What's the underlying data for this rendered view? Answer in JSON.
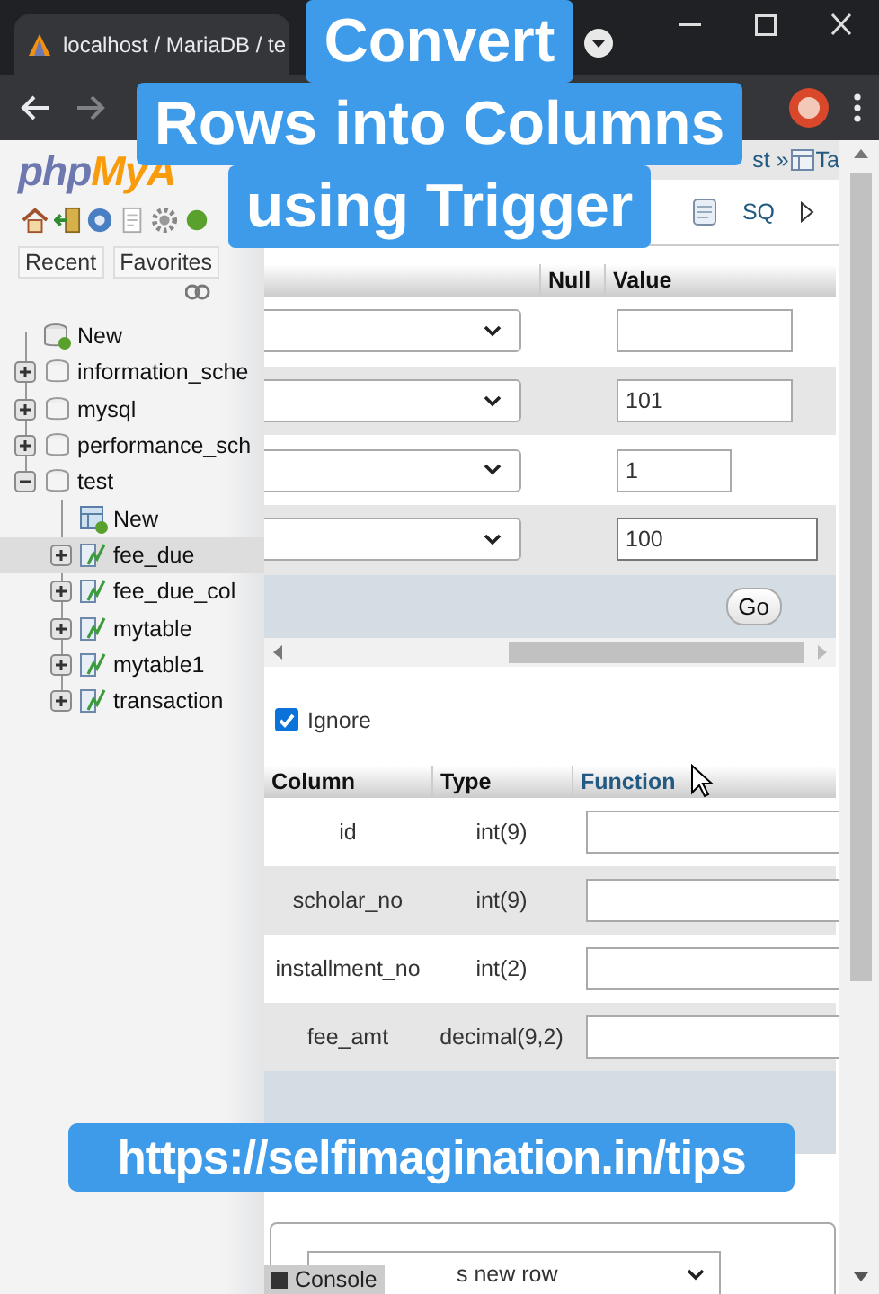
{
  "browser": {
    "tab_title": "localhost / MariaDB / te"
  },
  "captions": {
    "title_lines": [
      "Convert",
      "Rows into Columns",
      "using Trigger"
    ],
    "url": "https://selfimagination.in/tips"
  },
  "sidebar": {
    "logo": {
      "first": "php",
      "second": "MyA"
    },
    "buttons": [
      "Recent",
      "Favorites"
    ],
    "tree": [
      {
        "label": "New",
        "kind": "new",
        "selected": false
      },
      {
        "label": "information_sche",
        "kind": "db",
        "expanded": false,
        "selected": false
      },
      {
        "label": "mysql",
        "kind": "db",
        "expanded": false,
        "selected": false
      },
      {
        "label": "performance_sch",
        "kind": "db",
        "expanded": false,
        "selected": false
      },
      {
        "label": "test",
        "kind": "db",
        "expanded": true,
        "selected": false,
        "children": [
          {
            "label": "New",
            "kind": "new",
            "selected": false
          },
          {
            "label": "fee_due",
            "kind": "table",
            "expanded": false,
            "selected": true
          },
          {
            "label": "fee_due_col",
            "kind": "table",
            "expanded": false,
            "selected": false
          },
          {
            "label": "mytable",
            "kind": "table",
            "expanded": false,
            "selected": false
          },
          {
            "label": "mytable1",
            "kind": "table",
            "expanded": false,
            "selected": false
          },
          {
            "label": "transaction",
            "kind": "table",
            "expanded": false,
            "selected": false
          }
        ]
      }
    ]
  },
  "main": {
    "breadcrumb": [
      "st »",
      "Ta"
    ],
    "tabs": [
      {
        "label": "SQ",
        "selected": false
      }
    ],
    "insert_table": {
      "columns": [
        "Null",
        "Value"
      ],
      "rows": [
        {
          "value": "",
          "focused": false
        },
        {
          "value": "101",
          "focused": false
        },
        {
          "value": "1",
          "focused": false
        },
        {
          "value": "100",
          "focused": true
        }
      ]
    },
    "go_button": "Go",
    "ignore": {
      "label": "Ignore",
      "checked": true
    },
    "second_table": {
      "columns": [
        "Column",
        "Type",
        "Function"
      ],
      "rows": [
        {
          "column": "id",
          "type": "int(9)"
        },
        {
          "column": "scholar_no",
          "type": "int(9)"
        },
        {
          "column": "installment_no",
          "type": "int(2)"
        },
        {
          "column": "fee_amt",
          "type": "decimal(9,2)"
        }
      ]
    },
    "after_select": "s new row",
    "console_button": "Console"
  }
}
